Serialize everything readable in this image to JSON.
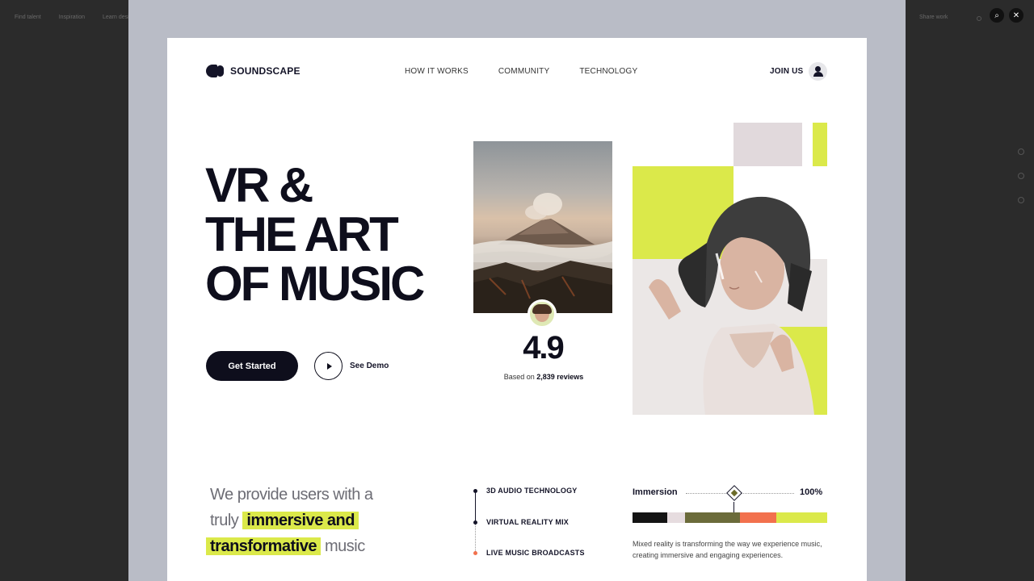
{
  "overlay": {
    "nav": [
      "Find talent",
      "Inspiration",
      "Learn design"
    ],
    "share_label": "Share work"
  },
  "brand": {
    "name": "SOUNDSCAPE",
    "dark": "#0e0e1c",
    "accent": "#dbe94a",
    "orange": "#f2714d"
  },
  "nav": {
    "items": [
      "HOW IT WORKS",
      "COMMUNITY",
      "TECHNOLOGY"
    ],
    "join_label": "JOIN US"
  },
  "hero": {
    "headline_lines": [
      "VR &",
      "THE ART",
      "OF MUSIC"
    ],
    "cta_primary": "Get Started",
    "cta_secondary": "See Demo"
  },
  "rating": {
    "score": "4.9",
    "reviews_prefix": "Based on",
    "reviews_count": "2,839 reviews"
  },
  "tagline": {
    "line1": "We provide users with a",
    "line2_plain": "truly",
    "line2_highlight": "immersive and",
    "line3_highlight": "transformative",
    "line3_plain": "music"
  },
  "features": [
    {
      "label": "3D AUDIO TECHNOLOGY"
    },
    {
      "label": "VIRTUAL REALITY MIX"
    },
    {
      "label": "LIVE MUSIC BROADCASTS"
    }
  ],
  "immersion": {
    "label": "Immersion",
    "value": "100%",
    "segments": [
      {
        "color": "#141414",
        "share": 0.18
      },
      {
        "color": "#e6dcdf",
        "share": 0.09
      },
      {
        "color": "#6b6b3a",
        "share": 0.28
      },
      {
        "color": "#f2714d",
        "share": 0.19
      },
      {
        "color": "#dbe94a",
        "share": 0.26
      }
    ],
    "description": "Mixed reality is transforming the way we experience music, creating immersive and engaging experiences."
  }
}
